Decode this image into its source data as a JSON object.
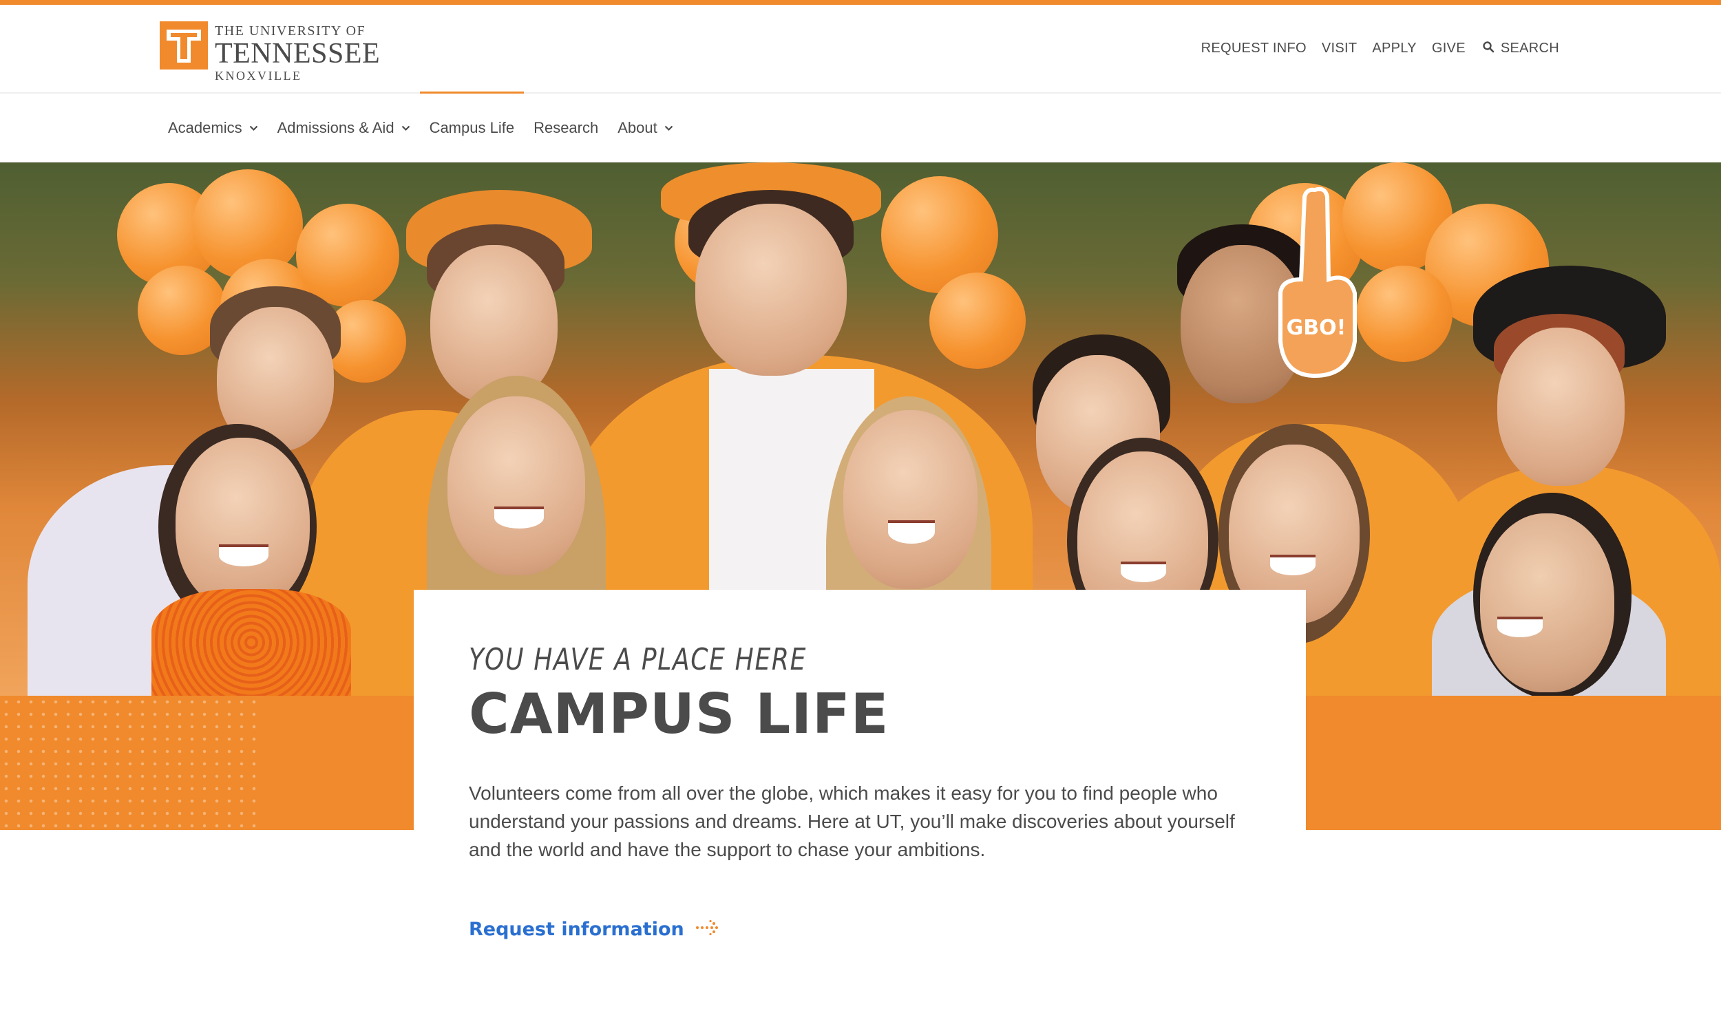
{
  "brand": {
    "line1": "THE UNIVERSITY OF",
    "line2": "TENNESSEE",
    "line3": "KNOXVILLE",
    "accent_color": "#f08a2c",
    "logo_icon": "power-t-icon"
  },
  "utility_nav": {
    "request_info": "REQUEST INFO",
    "visit": "VISIT",
    "apply": "APPLY",
    "give": "GIVE",
    "search": "SEARCH",
    "search_icon": "search-icon"
  },
  "main_nav": {
    "items": [
      {
        "label": "Academics",
        "has_dropdown": true
      },
      {
        "label": "Admissions & Aid",
        "has_dropdown": true
      },
      {
        "label": "Campus Life",
        "has_dropdown": false,
        "active": true
      },
      {
        "label": "Research",
        "has_dropdown": false
      },
      {
        "label": "About",
        "has_dropdown": true
      }
    ]
  },
  "hero": {
    "image": "group-of-students-in-orange-photo",
    "foam_finger_text": "GBO!"
  },
  "card": {
    "eyebrow": "YOU HAVE A PLACE HERE",
    "title": "CAMPUS LIFE",
    "body": "Volunteers come from all over the globe, which makes it easy for you to find people who understand your passions and dreams. Here at UT, you’ll make discoveries about yourself and the world and have the support to chase your ambitions.",
    "cta_label": "Request information",
    "cta_icon": "dotted-arrow-right-icon",
    "cta_color": "#2a6fd0"
  }
}
